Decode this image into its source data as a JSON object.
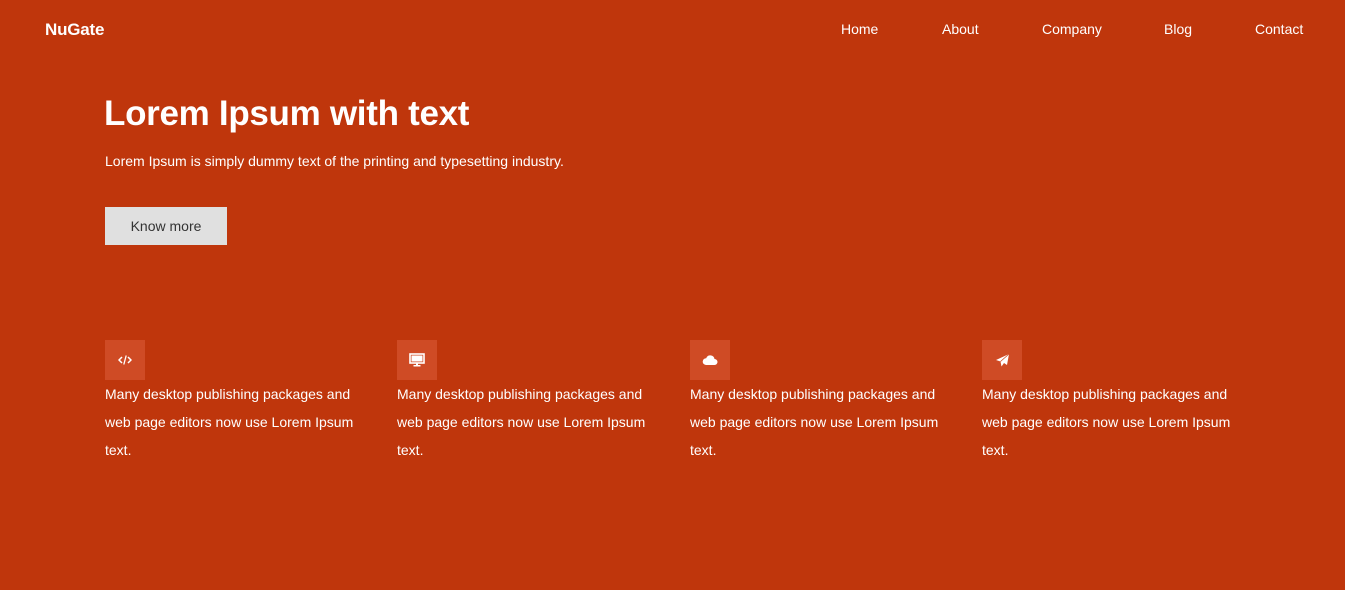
{
  "nav": {
    "brand": "NuGate",
    "items": [
      {
        "label": "Home"
      },
      {
        "label": "About"
      },
      {
        "label": "Company"
      },
      {
        "label": "Blog"
      },
      {
        "label": "Contact"
      }
    ]
  },
  "hero": {
    "title": "Lorem Ipsum with text",
    "subtitle": "Lorem Ipsum is simply dummy text of the printing and typesetting industry.",
    "button_label": "Know more"
  },
  "features": [
    {
      "icon": "code-icon",
      "text": "Many desktop publishing packages and web page editors now use Lorem Ipsum text."
    },
    {
      "icon": "desktop-icon",
      "text": "Many desktop publishing packages and web page editors now use Lorem Ipsum text."
    },
    {
      "icon": "cloud-icon",
      "text": "Many desktop publishing packages and web page editors now use Lorem Ipsum text."
    },
    {
      "icon": "paper-plane-icon",
      "text": "Many desktop publishing packages and web page editors now use Lorem Ipsum text."
    }
  ],
  "colors": {
    "background": "#bf360c",
    "icon_box": "#cf4b25",
    "button_bg": "#e0e0e0",
    "button_text": "#333333",
    "text": "#ffffff"
  }
}
